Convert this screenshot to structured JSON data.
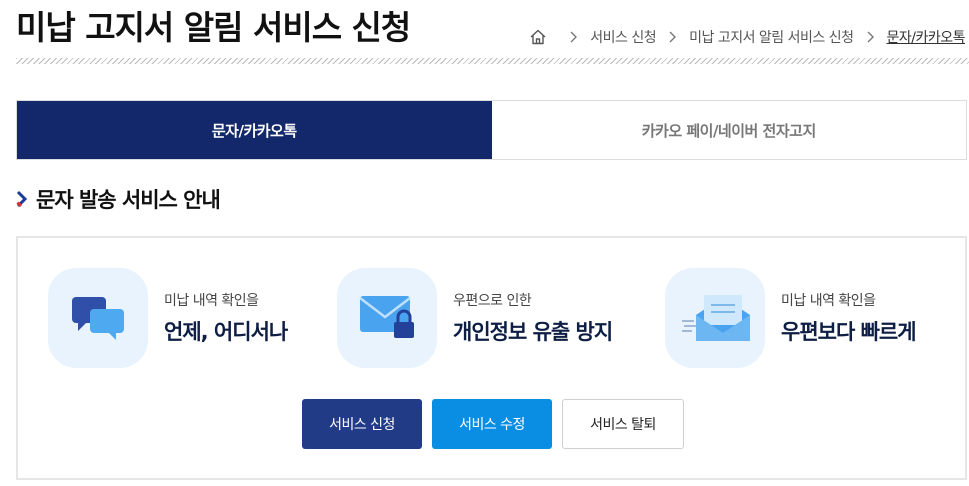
{
  "header": {
    "title": "미납 고지서 알림 서비스 신청"
  },
  "breadcrumb": {
    "home_icon": "home-icon",
    "items": [
      "서비스 신청",
      "미납 고지서 알림 서비스 신청",
      "문자/카카오톡"
    ]
  },
  "tabs": [
    {
      "label": "문자/카카오톡",
      "active": true
    },
    {
      "label": "카카오 페이/네이버 전자고지",
      "active": false
    }
  ],
  "section": {
    "title": "문자 발송 서비스 안내"
  },
  "features": [
    {
      "icon": "chat-bubbles-icon",
      "sub": "미납 내역 확인을",
      "main": "언제, 어디서나"
    },
    {
      "icon": "locked-envelope-icon",
      "sub": "우편으로 인한",
      "main": "개인정보 유출 방지"
    },
    {
      "icon": "fast-mail-icon",
      "sub": "미납 내역 확인을",
      "main": "우편보다 빠르게"
    }
  ],
  "buttons": {
    "apply": "서비스 신청",
    "modify": "서비스 수정",
    "withdraw": "서비스 탈퇴"
  },
  "colors": {
    "active_tab": "#13286a",
    "apply_button": "#223b86",
    "modify_button": "#0a8ee3",
    "icon_background": "#e8f3fd",
    "section_chevron": "#1a3a9c"
  }
}
